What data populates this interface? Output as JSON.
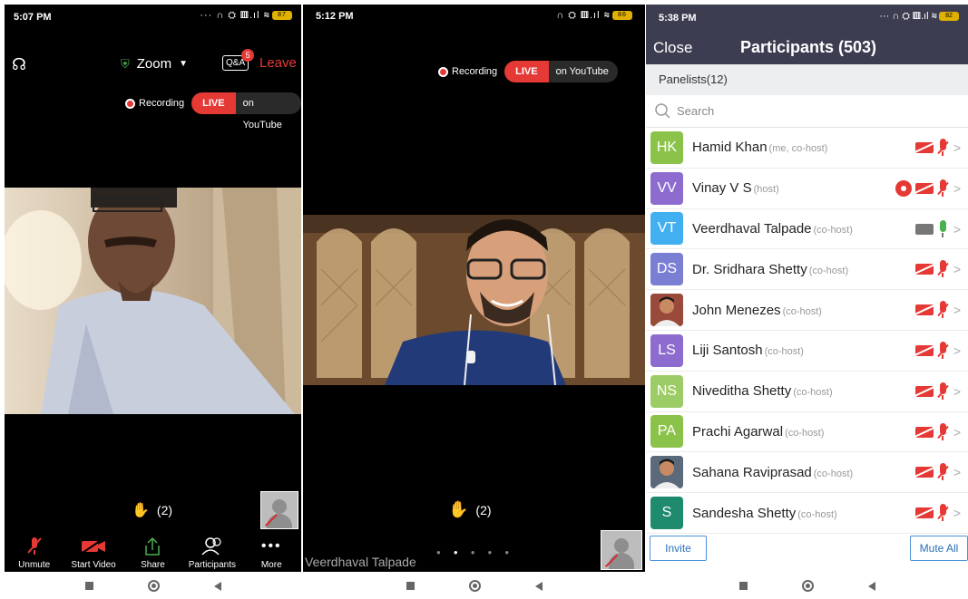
{
  "screen1": {
    "time": "5:07 PM",
    "battery": "87",
    "meeting_title": "Zoom",
    "qa_label": "Q&A",
    "qa_badge": "5",
    "leave_label": "Leave",
    "recording_label": "Recording",
    "live_label": "LIVE",
    "live_platform": "on YouTube",
    "hand_count": "(2)",
    "toolbar": [
      {
        "label": "Unmute",
        "icon": "mic-off-icon"
      },
      {
        "label": "Start Video",
        "icon": "video-off-icon"
      },
      {
        "label": "Share",
        "icon": "share-icon"
      },
      {
        "label": "Participants",
        "icon": "participants-icon"
      },
      {
        "label": "More",
        "icon": "more-icon"
      }
    ]
  },
  "screen2": {
    "time": "5:12 PM",
    "battery": "86",
    "recording_label": "Recording",
    "live_label": "LIVE",
    "live_platform": "on YouTube",
    "hand_count": "(2)",
    "speaker_name": "Veerdhaval Talpade"
  },
  "screen3": {
    "time": "5:38 PM",
    "battery": "82",
    "close_label": "Close",
    "title": "Participants (503)",
    "panelists_label": "Panelists(12)",
    "search_placeholder": "Search",
    "participants": [
      {
        "initials": "HK",
        "name": "Hamid Khan",
        "role": "(me, co-host)",
        "color": "#8bc34a",
        "photo": false,
        "recording": false,
        "video": false,
        "audio": false
      },
      {
        "initials": "VV",
        "name": "Vinay V S",
        "role": "(host)",
        "color": "#8e6ccf",
        "photo": false,
        "recording": true,
        "video": false,
        "audio": false
      },
      {
        "initials": "VT",
        "name": "Veerdhaval Talpade",
        "role": "(co-host)",
        "color": "#42b0f0",
        "photo": false,
        "recording": false,
        "video": true,
        "audio": true
      },
      {
        "initials": "DS",
        "name": "Dr. Sridhara Shetty",
        "role": "(co-host)",
        "color": "#7b7fd4",
        "photo": false,
        "recording": false,
        "video": false,
        "audio": false
      },
      {
        "initials": "",
        "name": "John Menezes",
        "role": "(co-host)",
        "color": "#9a4a3a",
        "photo": true,
        "recording": false,
        "video": false,
        "audio": false
      },
      {
        "initials": "LS",
        "name": "Liji Santosh",
        "role": "(co-host)",
        "color": "#8e6ccf",
        "photo": false,
        "recording": false,
        "video": false,
        "audio": false
      },
      {
        "initials": "NS",
        "name": "Niveditha Shetty",
        "role": "(co-host)",
        "color": "#9ccc65",
        "photo": false,
        "recording": false,
        "video": false,
        "audio": false
      },
      {
        "initials": "PA",
        "name": "Prachi Agarwal",
        "role": "(co-host)",
        "color": "#8bc34a",
        "photo": false,
        "recording": false,
        "video": false,
        "audio": false
      },
      {
        "initials": "",
        "name": "Sahana Raviprasad",
        "role": "(co-host)",
        "color": "#5a6a7a",
        "photo": true,
        "recording": false,
        "video": false,
        "audio": false
      },
      {
        "initials": "S",
        "name": "Sandesha Shetty",
        "role": "(co-host)",
        "color": "#1e8a6e",
        "photo": false,
        "recording": false,
        "video": false,
        "audio": false
      }
    ],
    "invite_label": "Invite",
    "mute_all_label": "Mute All"
  }
}
